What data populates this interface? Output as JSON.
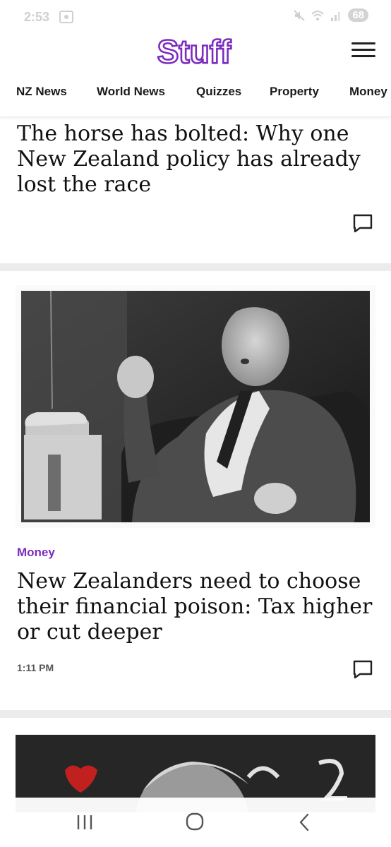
{
  "status_bar": {
    "time": "2:53",
    "battery": "68"
  },
  "header": {
    "logo_text": "Stuff",
    "brand_color": "#7b2cbf"
  },
  "nav": {
    "items": [
      {
        "label": "NZ News"
      },
      {
        "label": "World News"
      },
      {
        "label": "Quizzes"
      },
      {
        "label": "Property"
      },
      {
        "label": "Money"
      }
    ]
  },
  "articles": [
    {
      "headline": "The horse has bolted: Why one New Zealand policy has already lost the race"
    },
    {
      "category": "Money",
      "headline": "New Zealanders need to choose their financial poison: Tax higher or cut deeper",
      "time": "1:11 PM"
    }
  ],
  "icons": {
    "comment": "comment-icon",
    "menu": "hamburger-menu-icon",
    "recents": "recent-apps-icon",
    "home": "home-icon",
    "back": "back-icon"
  }
}
